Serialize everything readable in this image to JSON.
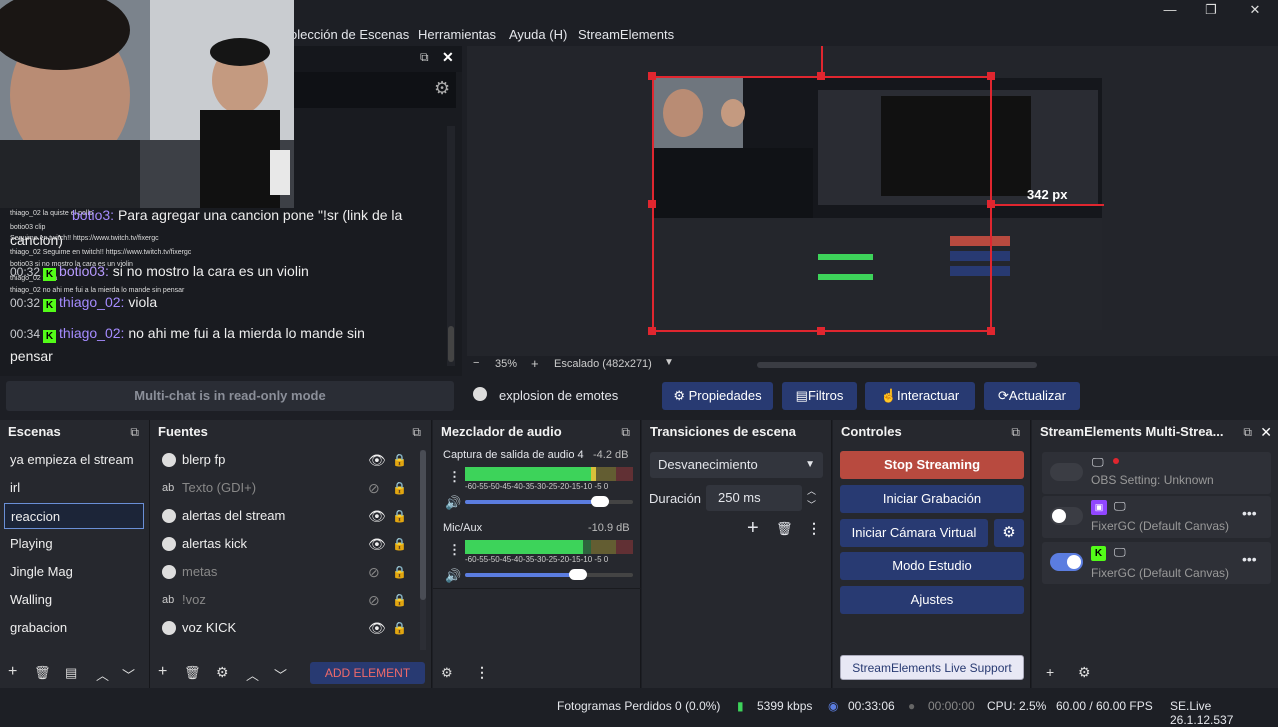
{
  "titlebar": {
    "minimize": "—",
    "maximize": "❐",
    "close": "✕"
  },
  "menu": {
    "items": [
      "olección de Escenas",
      "Herramientas",
      "Ayuda (H)",
      "StreamElements"
    ]
  },
  "chat": {
    "tiny_lines": [
      "thiago_02 la quiste el pollo",
      "botio03 clip",
      "Seguime en twitch!! https://www.twitch.tv/fixergc",
      "thiago_02 Seguime en twitch!! https://www.twitch.tv/fixergc",
      "botio03 si no mostro la cara es un violin",
      "thiago_02 viola",
      "thiago_02 no ahi me fui a la mierda lo mande sin pensar"
    ],
    "line1_name": "botio3:",
    "line1_text": "Para agregar una cancion pone \"!sr (link de la",
    "line1_cont": "cancion)",
    "line2_ts": "00:32",
    "line2_name": "botio03:",
    "line2_text": "si no mostro la cara es un violin",
    "line3_ts": "00:32",
    "line3_name": "thiago_02:",
    "line3_text": "viola",
    "line4_ts": "00:34",
    "line4_name": "thiago_02:",
    "line4_text": "no ahi me fui a la mierda lo mande sin",
    "line4_cont": "pensar",
    "readonly": "Multi-chat is in read-only mode"
  },
  "preview": {
    "dimension": "342 px"
  },
  "zoom": {
    "minus": "−",
    "level": "35%",
    "plus": "+",
    "scale": "Escalado (482x271)"
  },
  "source_toolbar": {
    "name": "explosion de emotes",
    "props": "Propiedades",
    "filters": "Filtros",
    "interact": "Interactuar",
    "refresh": "Actualizar"
  },
  "scenes": {
    "title": "Escenas",
    "items": [
      "ya empieza el stream",
      "irl",
      "reaccion",
      "Playing",
      "Jingle Mag",
      "Walling",
      "grabacion"
    ]
  },
  "sources": {
    "title": "Fuentes",
    "items": [
      {
        "name": "blerp fp",
        "type": "browser",
        "hidden": false
      },
      {
        "name": "Texto (GDI+)",
        "type": "text",
        "hidden": true
      },
      {
        "name": "alertas del stream",
        "type": "browser",
        "hidden": false
      },
      {
        "name": "alertas kick",
        "type": "browser",
        "hidden": false
      },
      {
        "name": "metas",
        "type": "browser",
        "hidden": true
      },
      {
        "name": "!voz",
        "type": "text",
        "hidden": true
      },
      {
        "name": "voz KICK",
        "type": "browser",
        "hidden": false
      }
    ],
    "add_element": "ADD ELEMENT"
  },
  "mixer": {
    "title": "Mezclador de audio",
    "tracks": [
      {
        "name": "Captura de salida de audio 4",
        "db": "-4.2 dB",
        "level": 0.78,
        "volume": 0.85
      },
      {
        "name": "Mic/Aux",
        "db": "-10.9 dB",
        "level": 0.7,
        "volume": 0.72
      }
    ],
    "scale": "-60-55-50-45-40-35-30-25-20-15-10 -5  0"
  },
  "transitions": {
    "title": "Transiciones de escena",
    "selected": "Desvanecimiento",
    "duration_label": "Duración",
    "duration": "250 ms"
  },
  "controls": {
    "title": "Controles",
    "stop": "Stop Streaming",
    "record": "Iniciar Grabación",
    "vcam": "Iniciar Cámara Virtual",
    "studio": "Modo Estudio",
    "settings": "Ajustes",
    "support": "StreamElements Live Support"
  },
  "multistream": {
    "title": "StreamElements Multi-Strea...",
    "rows": [
      {
        "label": "OBS Setting: Unknown",
        "on": false
      },
      {
        "label": "FixerGC (Default Canvas)",
        "on": false
      },
      {
        "label": "FixerGC (Default Canvas)",
        "on": true
      }
    ]
  },
  "status": {
    "frames": "Fotogramas Perdidos 0 (0.0%)",
    "kbps": "5399 kbps",
    "stream_time": "00:33:06",
    "rec_time": "00:00:00",
    "cpu": "CPU: 2.5%",
    "fps": "60.00 / 60.00 FPS",
    "version": "SE.Live 26.1.12.537"
  },
  "colors": {
    "accent": "#283a72",
    "stop": "#b84a3f",
    "kick": "#53fc18",
    "twitch": "#9146ff",
    "selection": "#e0262f"
  }
}
